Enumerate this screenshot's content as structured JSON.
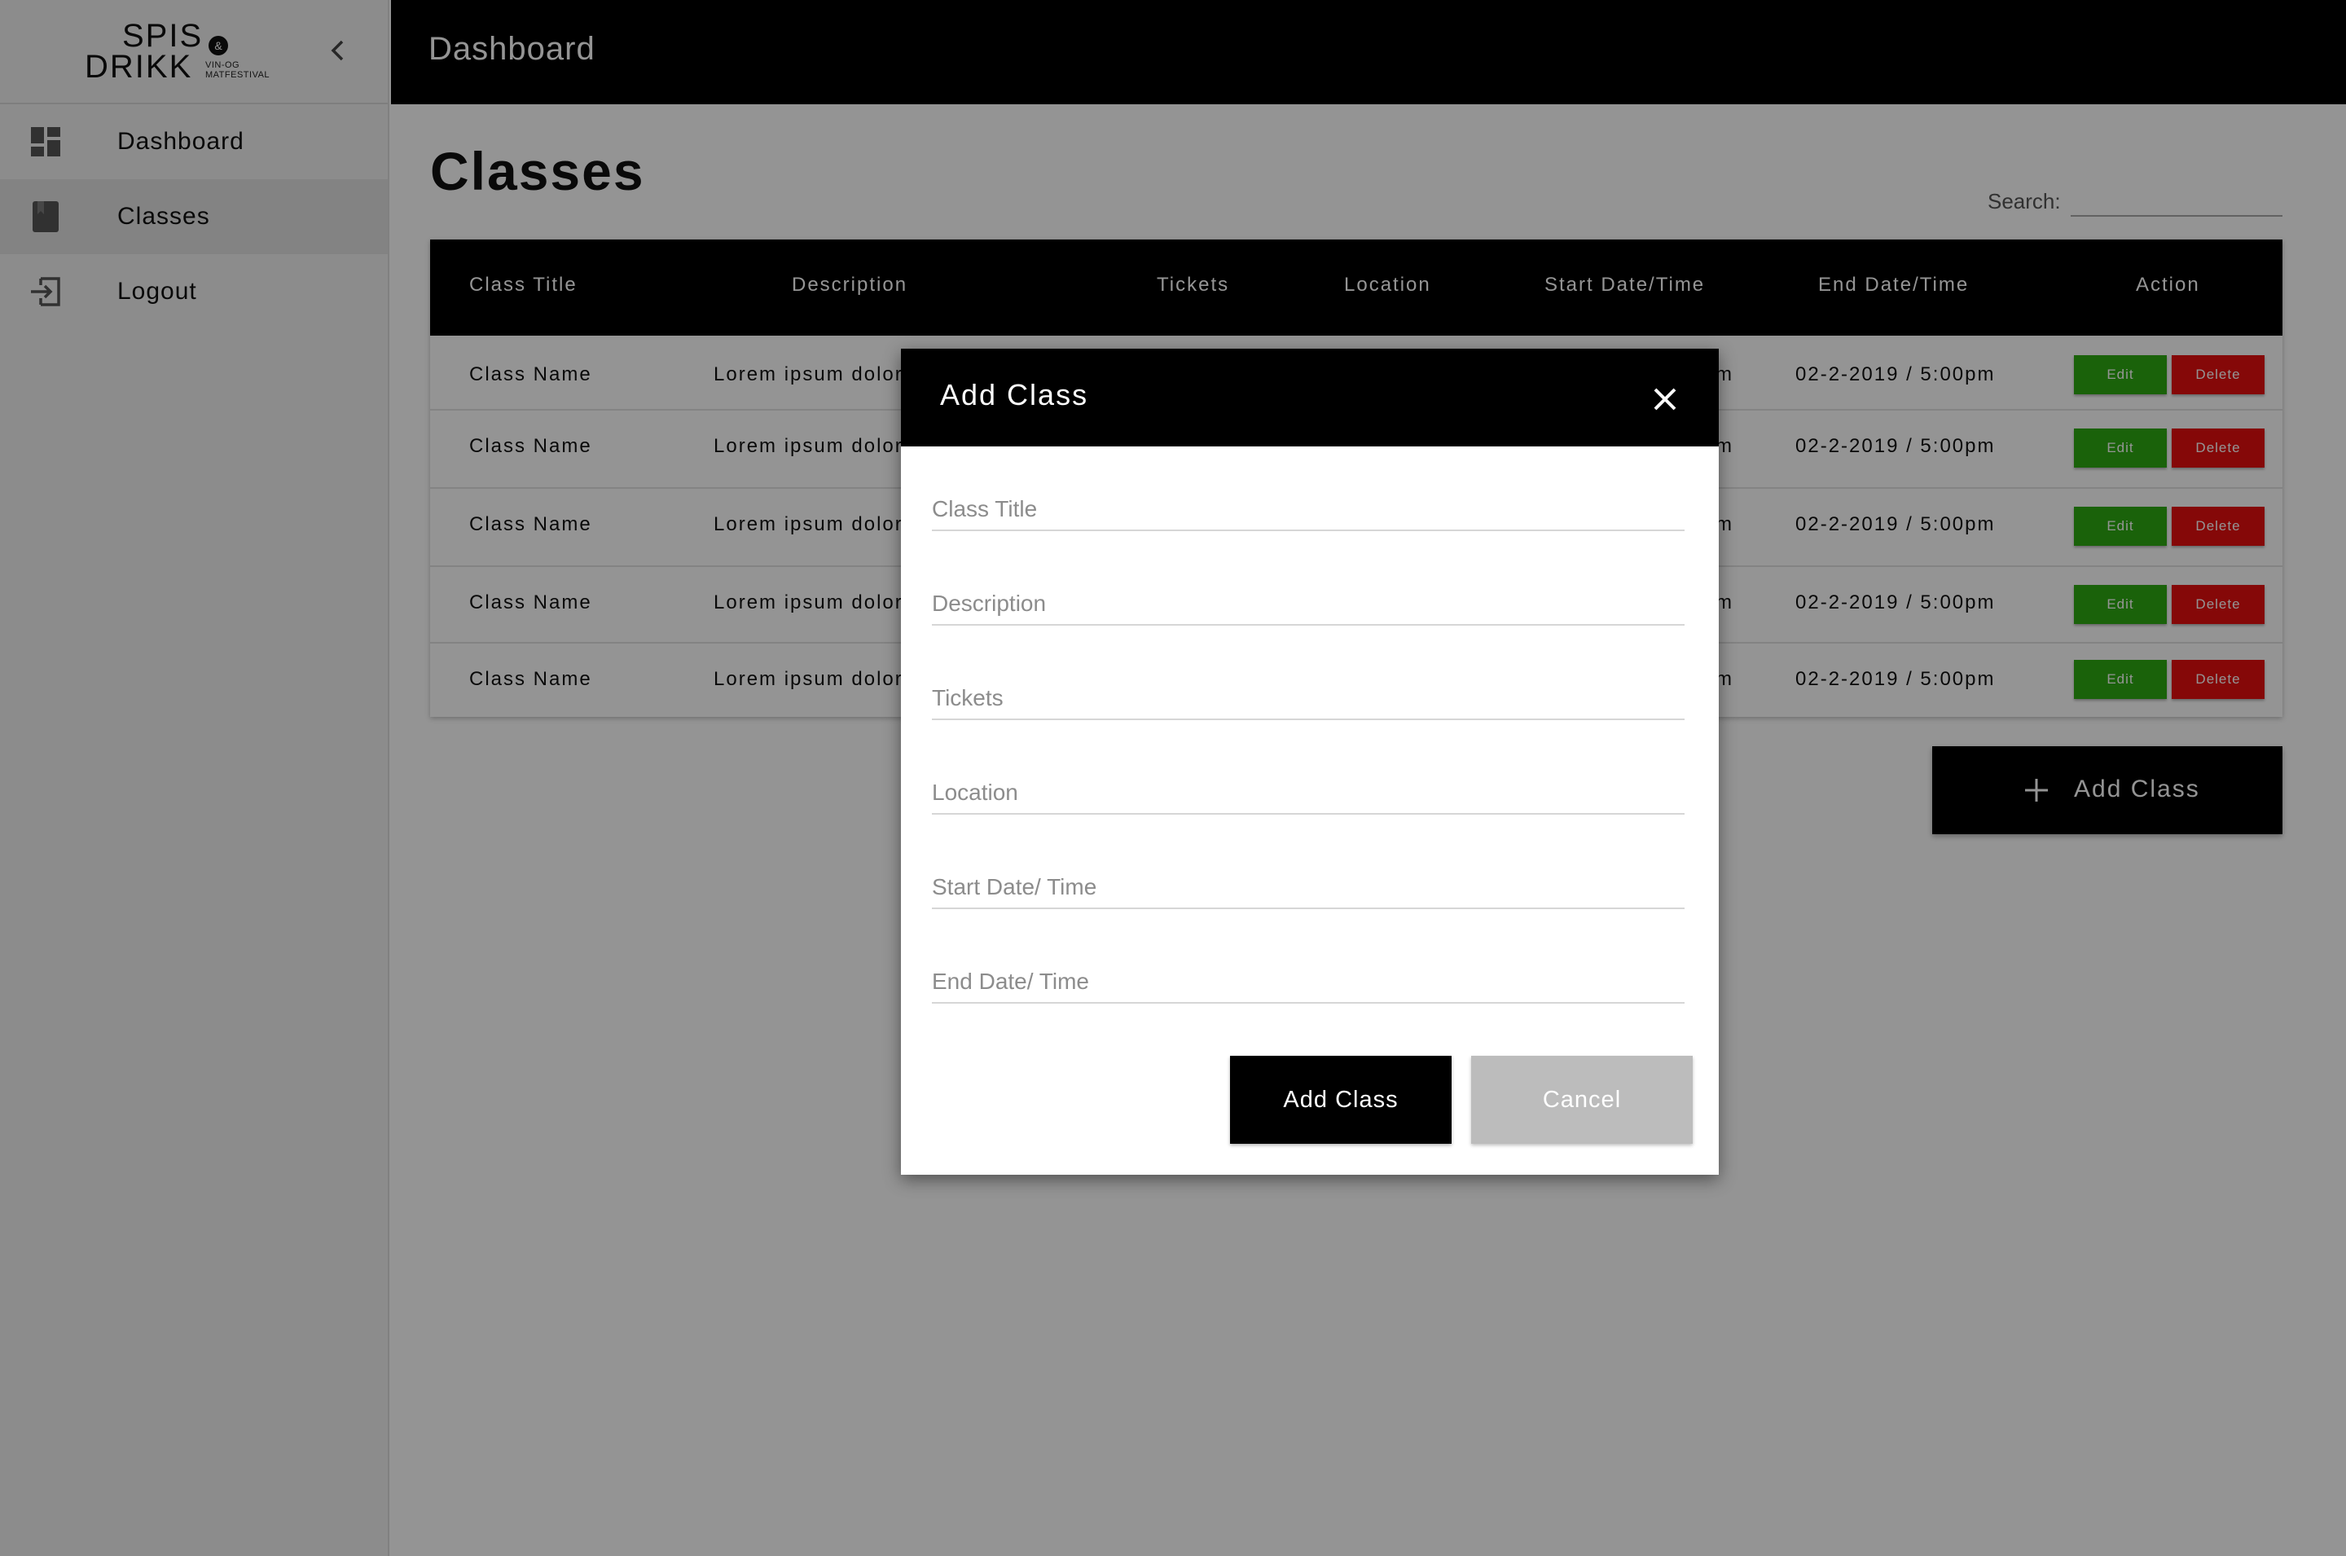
{
  "brand": {
    "line1": "SPIS",
    "line2": "DRIKK",
    "amp": "&",
    "sub1": "VIN-OG",
    "sub2": "MATFESTIVAL"
  },
  "sidebar": {
    "collapse_icon": "chevron-left-icon",
    "items": [
      {
        "label": "Dashboard",
        "icon": "dashboard-icon"
      },
      {
        "label": "Classes",
        "icon": "book-icon",
        "active": true
      },
      {
        "label": "Logout",
        "icon": "logout-icon"
      }
    ]
  },
  "header": {
    "title": "Dashboard"
  },
  "main": {
    "page_title": "Classes",
    "search_label": "Search:",
    "search_value": "",
    "add_button_label": "Add Class"
  },
  "table": {
    "columns": [
      "Class Title",
      "Description",
      "Tickets",
      "Location",
      "Start Date/Time",
      "End Date/Time",
      "Action"
    ],
    "rows": [
      {
        "title": "Class Name",
        "description": "Lorem ipsum dolor",
        "start_tail": "m",
        "end": "02-2-2019 / 5:00pm"
      },
      {
        "title": "Class Name",
        "description": "Lorem ipsum dolor",
        "start_tail": "m",
        "end": "02-2-2019 / 5:00pm"
      },
      {
        "title": "Class Name",
        "description": "Lorem ipsum dolor",
        "start_tail": "m",
        "end": "02-2-2019 / 5:00pm"
      },
      {
        "title": "Class Name",
        "description": "Lorem ipsum dolor",
        "start_tail": "m",
        "end": "02-2-2019 / 5:00pm"
      },
      {
        "title": "Class Name",
        "description": "Lorem ipsum dolor",
        "start_tail": "m",
        "end": "02-2-2019 / 5:00pm"
      }
    ],
    "edit_label": "Edit",
    "delete_label": "Delete"
  },
  "modal": {
    "title": "Add Class",
    "fields": [
      {
        "placeholder": "Class Title",
        "value": ""
      },
      {
        "placeholder": "Description",
        "value": ""
      },
      {
        "placeholder": "Tickets",
        "value": ""
      },
      {
        "placeholder": "Location",
        "value": ""
      },
      {
        "placeholder": "Start Date/ Time",
        "value": ""
      },
      {
        "placeholder": "End Date/ Time",
        "value": ""
      }
    ],
    "submit_label": "Add Class",
    "cancel_label": "Cancel"
  },
  "colors": {
    "edit": "#2eaa12",
    "delete": "#e60f0f",
    "primary": "#000000",
    "cancel": "#bcbcbc"
  }
}
